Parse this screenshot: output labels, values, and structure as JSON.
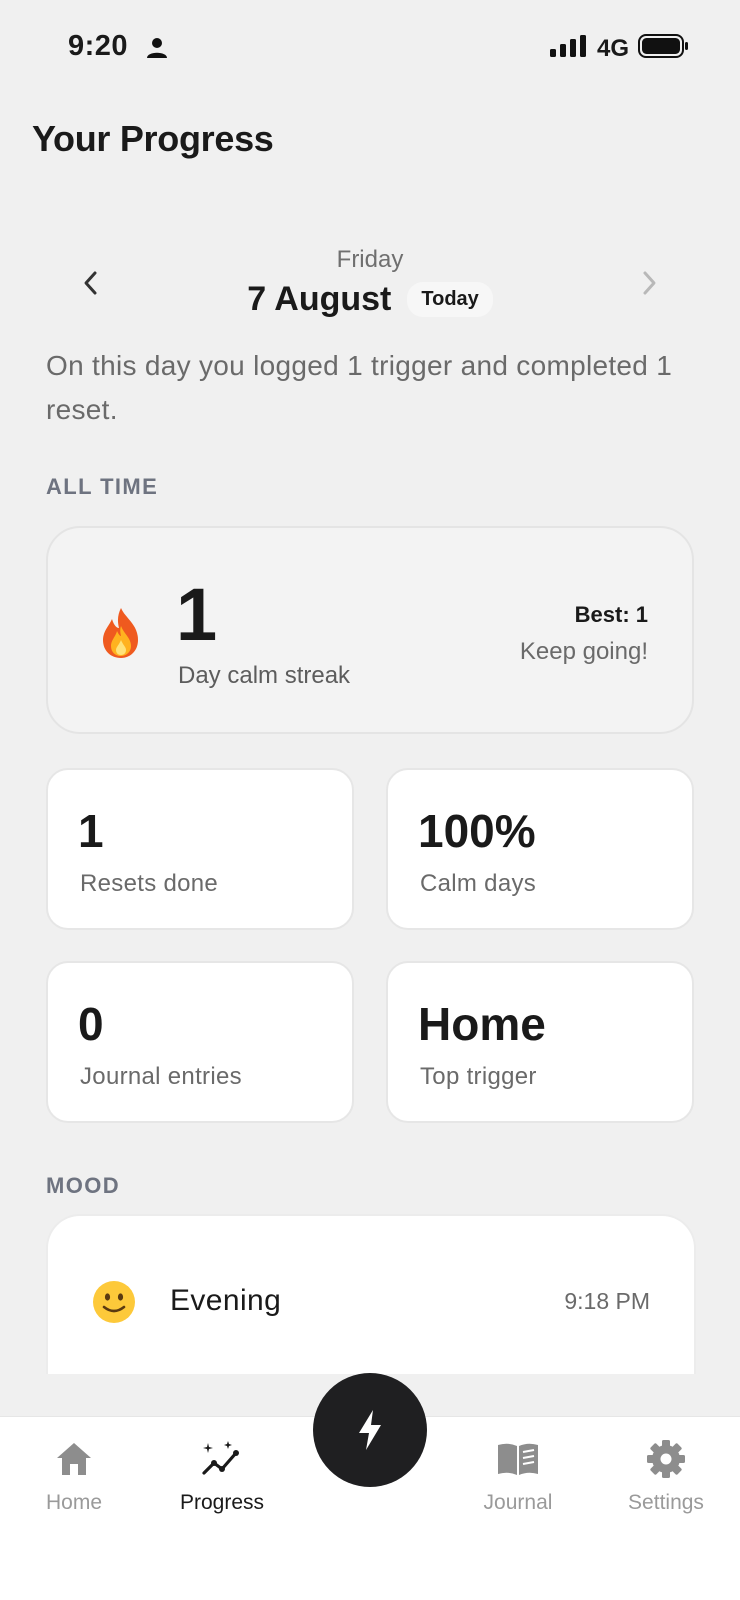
{
  "status_bar": {
    "time": "9:20",
    "network": "4G"
  },
  "header": {
    "title": "Your Progress"
  },
  "date_nav": {
    "day": "Friday",
    "date": "7 August",
    "badge": "Today"
  },
  "summary": "On this day you logged 1 trigger and completed 1 reset.",
  "all_time": {
    "label": "ALL TIME",
    "streak": {
      "value": "1",
      "label": "Day calm streak",
      "best": "Best: 1",
      "message": "Keep going!"
    },
    "stats": [
      {
        "value": "1",
        "label": "Resets done"
      },
      {
        "value": "100%",
        "label": "Calm days"
      },
      {
        "value": "0",
        "label": "Journal entries"
      },
      {
        "value": "Home",
        "label": "Top trigger"
      }
    ]
  },
  "mood": {
    "label": "MOOD",
    "entries": [
      {
        "emoji": "slightly-smiling-face-icon",
        "name": "Evening",
        "time": "9:18 PM"
      }
    ]
  },
  "tabs": [
    {
      "label": "Home",
      "icon": "house-icon",
      "active": false
    },
    {
      "label": "Progress",
      "icon": "sparkle-chart-icon",
      "active": true
    },
    {
      "label": "Journal",
      "icon": "book-icon",
      "active": false
    },
    {
      "label": "Settings",
      "icon": "gear-icon",
      "active": false
    }
  ],
  "fab": {
    "icon": "lightning-bolt-icon"
  },
  "colors": {
    "background": "#f0f0f0",
    "card": "#ffffff",
    "fab": "#1f1f21",
    "muted": "#6a6a6a",
    "inactive_tab": "#9a9a9a"
  }
}
